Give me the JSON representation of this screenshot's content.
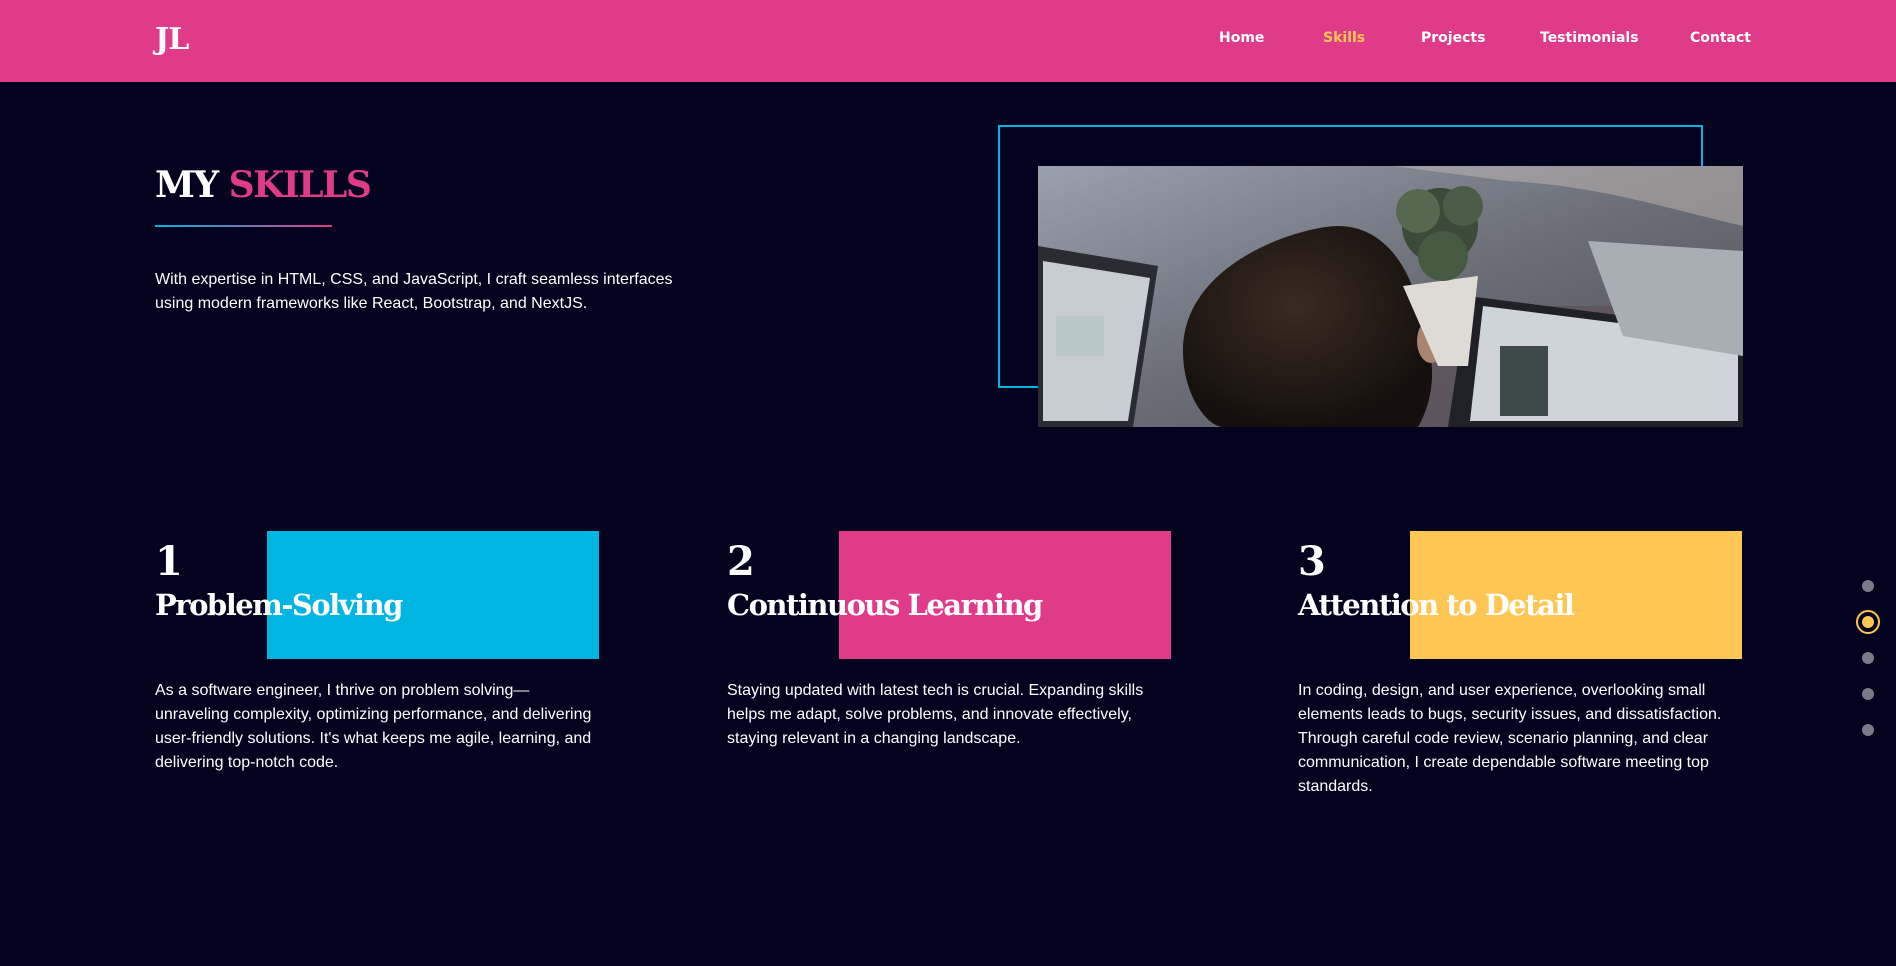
{
  "navbar": {
    "logo": "JL",
    "links": [
      {
        "label": "Home",
        "active": false
      },
      {
        "label": "Skills",
        "active": true
      },
      {
        "label": "Projects",
        "active": false
      },
      {
        "label": "Testimonials",
        "active": false
      },
      {
        "label": "Contact",
        "active": false
      }
    ]
  },
  "skills": {
    "heading_prefix": "MY",
    "heading_accent": "SKILLS",
    "intro": "With expertise in HTML, CSS, and JavaScript, I craft seamless interfaces using modern frameworks like React, Bootstrap, and NextJS.",
    "cards": [
      {
        "number": "1",
        "title": "Problem-Solving",
        "text": "As a software engineer, I thrive on problem solving—unraveling complexity, optimizing performance, and delivering user-friendly solutions. It's what keeps me agile, learning, and delivering top-notch code.",
        "color": "#00b5e2"
      },
      {
        "number": "2",
        "title": "Continuous Learning",
        "text": "Staying updated with latest tech is crucial. Expanding skills helps me adapt, solve problems, and innovate effectively, staying relevant in a changing landscape.",
        "color": "#e03b88"
      },
      {
        "number": "3",
        "title": "Attention to Detail",
        "text": "In coding, design, and user experience, overlooking small elements leads to bugs, security issues, and dissatisfaction. Through careful code review, scenario planning, and clear communication, I create dependable software meeting top standards.",
        "color": "#ffc654"
      }
    ]
  },
  "section_dots": {
    "count": 5,
    "active_index": 1
  },
  "colors": {
    "navbar_bg": "#e03b88",
    "page_bg": "#03021f",
    "accent_pink": "#e03b88",
    "accent_blue": "#00b5e2",
    "accent_yellow": "#ffc654"
  }
}
